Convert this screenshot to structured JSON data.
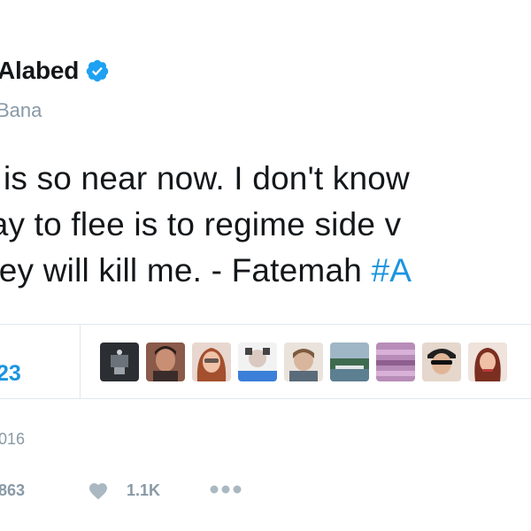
{
  "tweet": {
    "author_name": "Alabed",
    "handle": "Bana",
    "text_lines": [
      "is so near now. I don't know",
      "vay to flee is to regime side v",
      "hey will kill me. - Fatemah "
    ],
    "hashtag": "#A",
    "likes_count": "23",
    "date": "016",
    "retweets_count": "863",
    "likes_action_count": "1.1K"
  },
  "liker_avatars": [
    "avatar-1",
    "avatar-2",
    "avatar-3",
    "avatar-4",
    "avatar-5",
    "avatar-6",
    "avatar-7",
    "avatar-8",
    "avatar-9"
  ],
  "colors": {
    "link": "#1b95e0",
    "muted": "#8899a6",
    "verified": "#1da1f2",
    "divider": "#e1e8ed"
  },
  "icons": {
    "verified": "verified-badge-icon",
    "like": "heart-icon",
    "more": "more-dots-icon"
  }
}
